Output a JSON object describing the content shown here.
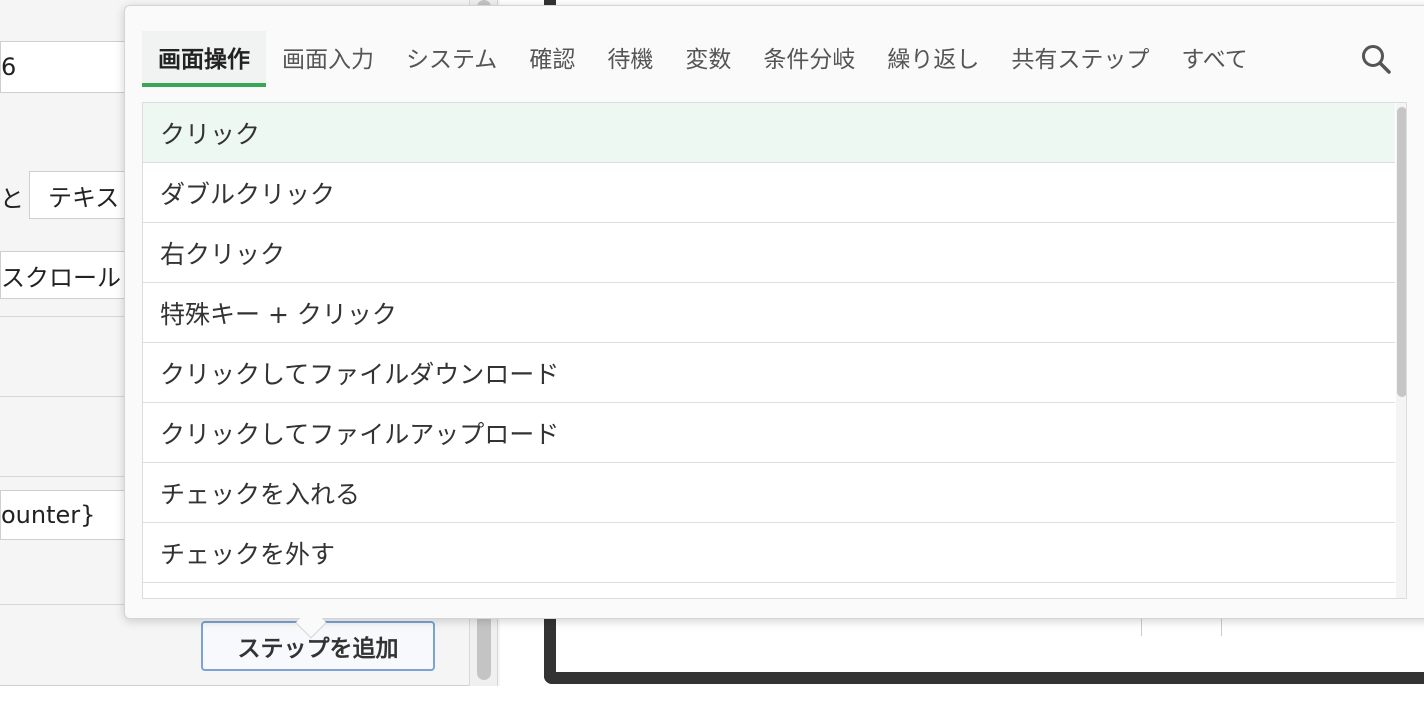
{
  "form": {
    "field1_value": "6",
    "label_to": "と",
    "field2_value": "テキス",
    "scroll_text": "スクロール",
    "field3_value": "ounter}",
    "add_step_label": "ステップを追加"
  },
  "popover": {
    "tabs": [
      {
        "label": "画面操作",
        "active": true
      },
      {
        "label": "画面入力"
      },
      {
        "label": "システム"
      },
      {
        "label": "確認"
      },
      {
        "label": "待機"
      },
      {
        "label": "変数"
      },
      {
        "label": "条件分岐"
      },
      {
        "label": "繰り返し"
      },
      {
        "label": "共有ステップ"
      },
      {
        "label": "すべて"
      }
    ],
    "search_icon": "search-icon",
    "items": [
      {
        "label": "クリック",
        "highlighted": true
      },
      {
        "label": "ダブルクリック"
      },
      {
        "label": "右クリック"
      },
      {
        "label": "特殊キー + クリック"
      },
      {
        "label": "クリックしてファイルダウンロード"
      },
      {
        "label": "クリックしてファイルアップロード"
      },
      {
        "label": "チェックを入れる"
      },
      {
        "label": "チェックを外す"
      }
    ]
  },
  "colors": {
    "active_tab_underline": "#3aa757",
    "highlight_row": "#eef8f3",
    "button_border": "#7aa3d6",
    "frame_dark": "#333333"
  }
}
